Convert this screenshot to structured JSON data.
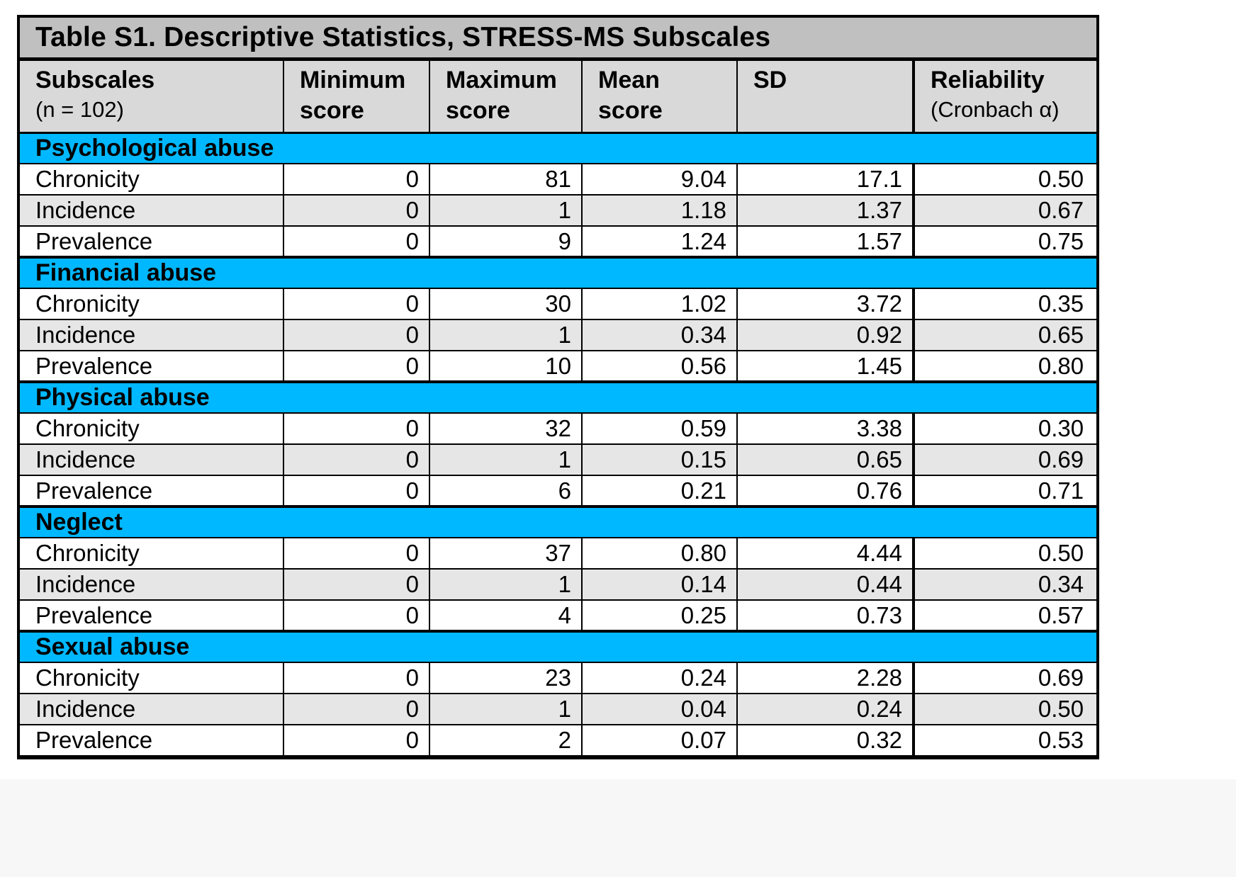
{
  "title": "Table S1. Descriptive Statistics, STRESS-MS Subscales",
  "columns": [
    {
      "label": "Subscales",
      "sub": "(n = 102)"
    },
    {
      "label": "Minimum",
      "sub_bold": "score"
    },
    {
      "label": "Maximum",
      "sub_bold": "score"
    },
    {
      "label": "Mean",
      "sub_bold": "score"
    },
    {
      "label": "SD"
    },
    {
      "label": "Reliability",
      "sub": "(Cronbach α)"
    }
  ],
  "sections": [
    {
      "name": "Psychological abuse",
      "rows": [
        {
          "label": "Chronicity",
          "min": "0",
          "max": "81",
          "mean": "9.04",
          "sd": "17.1",
          "alpha": "0.50"
        },
        {
          "label": "Incidence",
          "min": "0",
          "max": "1",
          "mean": "1.18",
          "sd": "1.37",
          "alpha": "0.67"
        },
        {
          "label": "Prevalence",
          "min": "0",
          "max": "9",
          "mean": "1.24",
          "sd": "1.57",
          "alpha": "0.75"
        }
      ]
    },
    {
      "name": "Financial abuse",
      "rows": [
        {
          "label": "Chronicity",
          "min": "0",
          "max": "30",
          "mean": "1.02",
          "sd": "3.72",
          "alpha": "0.35"
        },
        {
          "label": "Incidence",
          "min": "0",
          "max": "1",
          "mean": "0.34",
          "sd": "0.92",
          "alpha": "0.65"
        },
        {
          "label": "Prevalence",
          "min": "0",
          "max": "10",
          "mean": "0.56",
          "sd": "1.45",
          "alpha": "0.80"
        }
      ]
    },
    {
      "name": "Physical abuse",
      "rows": [
        {
          "label": "Chronicity",
          "min": "0",
          "max": "32",
          "mean": "0.59",
          "sd": "3.38",
          "alpha": "0.30"
        },
        {
          "label": "Incidence",
          "min": "0",
          "max": "1",
          "mean": "0.15",
          "sd": "0.65",
          "alpha": "0.69"
        },
        {
          "label": "Prevalence",
          "min": "0",
          "max": "6",
          "mean": "0.21",
          "sd": "0.76",
          "alpha": "0.71"
        }
      ]
    },
    {
      "name": "Neglect",
      "rows": [
        {
          "label": "Chronicity",
          "min": "0",
          "max": "37",
          "mean": "0.80",
          "sd": "4.44",
          "alpha": "0.50"
        },
        {
          "label": "Incidence",
          "min": "0",
          "max": "1",
          "mean": "0.14",
          "sd": "0.44",
          "alpha": "0.34"
        },
        {
          "label": "Prevalence",
          "min": "0",
          "max": "4",
          "mean": "0.25",
          "sd": "0.73",
          "alpha": "0.57"
        }
      ]
    },
    {
      "name": "Sexual abuse",
      "rows": [
        {
          "label": "Chronicity",
          "min": "0",
          "max": "23",
          "mean": "0.24",
          "sd": "2.28",
          "alpha": "0.69"
        },
        {
          "label": "Incidence",
          "min": "0",
          "max": "1",
          "mean": "0.04",
          "sd": "0.24",
          "alpha": "0.50"
        },
        {
          "label": "Prevalence",
          "min": "0",
          "max": "2",
          "mean": "0.07",
          "sd": "0.32",
          "alpha": "0.53"
        }
      ]
    }
  ],
  "colors": {
    "title_bg": "#c0c0c0",
    "header_bg": "#d9d9d9",
    "section_bg": "#00b8ff",
    "alt_row_bg": "#e6e6e6"
  }
}
